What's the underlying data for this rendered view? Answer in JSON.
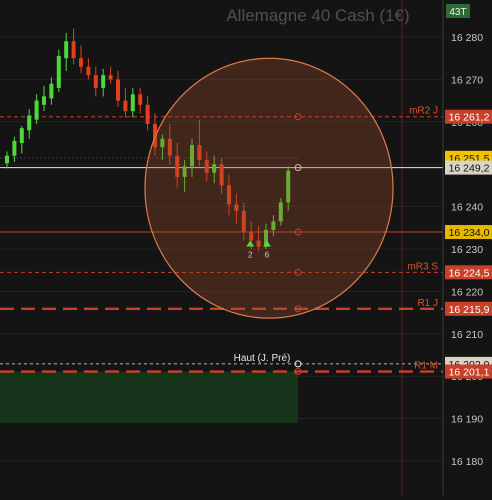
{
  "title": "Allemagne 40 Cash (1€)",
  "timeframe_badge": "43T",
  "colors": {
    "background": "#141414",
    "bull": "#4fd83a",
    "bear": "#e0401f",
    "level_line": "#c8402a",
    "white_line": "#e8e8e8",
    "circle_fill": "#a24f2c",
    "circle_stroke": "#e07a4a",
    "zone_fill": "#16391a",
    "label_bg": "#d8d4c8",
    "axis_text": "#c8c8c8",
    "title_text": "#505050",
    "level_text": "#e05030",
    "grid": "#2a2a2a"
  },
  "chart_data": {
    "type": "candlestick",
    "title": "Allemagne 40 Cash (1€)",
    "instrument": "Allemagne 40 Cash (1€)",
    "timeframe": "43T",
    "ylim": [
      16180,
      16288
    ],
    "y_ticks": [
      16280,
      16270,
      16260,
      16250,
      16240,
      16230,
      16220,
      16210,
      16200,
      16190,
      16180
    ],
    "y_tick_labels": [
      "16 280",
      "16 270",
      "16 260",
      "16 250",
      "16 240",
      "16 230",
      "16 220",
      "16 210",
      "16 200",
      "16 190",
      "16 180"
    ],
    "candles": [
      {
        "o": 16250.2,
        "h": 16253.0,
        "l": 16249.0,
        "c": 16252.0
      },
      {
        "o": 16252.0,
        "h": 16256.5,
        "l": 16250.5,
        "c": 16255.5
      },
      {
        "o": 16255.0,
        "h": 16259.0,
        "l": 16252.5,
        "c": 16258.5
      },
      {
        "o": 16258.0,
        "h": 16263.0,
        "l": 16256.0,
        "c": 16261.5
      },
      {
        "o": 16260.5,
        "h": 16266.5,
        "l": 16259.5,
        "c": 16265.0
      },
      {
        "o": 16264.0,
        "h": 16268.5,
        "l": 16262.5,
        "c": 16266.0
      },
      {
        "o": 16265.5,
        "h": 16270.5,
        "l": 16264.0,
        "c": 16269.0
      },
      {
        "o": 16268.0,
        "h": 16277.0,
        "l": 16267.0,
        "c": 16275.5
      },
      {
        "o": 16275.0,
        "h": 16281.0,
        "l": 16272.0,
        "c": 16279.0
      },
      {
        "o": 16279.0,
        "h": 16282.0,
        "l": 16273.5,
        "c": 16275.0
      },
      {
        "o": 16275.0,
        "h": 16278.0,
        "l": 16271.5,
        "c": 16273.0
      },
      {
        "o": 16273.0,
        "h": 16275.0,
        "l": 16270.0,
        "c": 16271.0
      },
      {
        "o": 16271.0,
        "h": 16273.0,
        "l": 16266.0,
        "c": 16268.0
      },
      {
        "o": 16268.0,
        "h": 16272.5,
        "l": 16266.0,
        "c": 16271.0
      },
      {
        "o": 16271.0,
        "h": 16273.0,
        "l": 16269.0,
        "c": 16270.0
      },
      {
        "o": 16270.0,
        "h": 16272.0,
        "l": 16263.5,
        "c": 16265.0
      },
      {
        "o": 16265.0,
        "h": 16268.0,
        "l": 16261.0,
        "c": 16262.5
      },
      {
        "o": 16262.5,
        "h": 16268.0,
        "l": 16261.0,
        "c": 16266.5
      },
      {
        "o": 16266.5,
        "h": 16268.0,
        "l": 16262.0,
        "c": 16264.0
      },
      {
        "o": 16264.0,
        "h": 16266.0,
        "l": 16258.0,
        "c": 16259.5
      },
      {
        "o": 16259.5,
        "h": 16262.0,
        "l": 16252.0,
        "c": 16254.0
      },
      {
        "o": 16254.0,
        "h": 16257.0,
        "l": 16251.0,
        "c": 16256.0
      },
      {
        "o": 16256.0,
        "h": 16259.5,
        "l": 16250.0,
        "c": 16252.0
      },
      {
        "o": 16252.0,
        "h": 16255.0,
        "l": 16244.5,
        "c": 16247.0
      },
      {
        "o": 16247.0,
        "h": 16251.0,
        "l": 16243.5,
        "c": 16249.5
      },
      {
        "o": 16249.5,
        "h": 16256.0,
        "l": 16247.0,
        "c": 16254.5
      },
      {
        "o": 16254.5,
        "h": 16260.5,
        "l": 16249.5,
        "c": 16251.0
      },
      {
        "o": 16251.0,
        "h": 16253.0,
        "l": 16246.0,
        "c": 16248.0
      },
      {
        "o": 16248.0,
        "h": 16252.0,
        "l": 16245.5,
        "c": 16250.0
      },
      {
        "o": 16250.0,
        "h": 16251.5,
        "l": 16243.0,
        "c": 16245.0
      },
      {
        "o": 16245.0,
        "h": 16247.5,
        "l": 16238.0,
        "c": 16240.5
      },
      {
        "o": 16240.5,
        "h": 16243.0,
        "l": 16236.0,
        "c": 16239.0
      },
      {
        "o": 16239.0,
        "h": 16241.0,
        "l": 16232.0,
        "c": 16234.0
      },
      {
        "o": 16234.0,
        "h": 16236.5,
        "l": 16230.0,
        "c": 16232.0
      },
      {
        "o": 16232.0,
        "h": 16235.5,
        "l": 16229.5,
        "c": 16230.5
      },
      {
        "o": 16230.5,
        "h": 16236.0,
        "l": 16230.0,
        "c": 16234.5
      },
      {
        "o": 16234.5,
        "h": 16238.0,
        "l": 16233.0,
        "c": 16236.5
      },
      {
        "o": 16236.5,
        "h": 16242.0,
        "l": 16235.5,
        "c": 16241.0
      },
      {
        "o": 16241.0,
        "h": 16249.5,
        "l": 16239.0,
        "c": 16248.5
      }
    ],
    "levels": [
      {
        "name": "mR2 J",
        "value": 16261.2,
        "price_label": "16 261,2",
        "style": "dashed-thin"
      },
      {
        "name": "",
        "value": 16251.5,
        "price_label": "16 251,5",
        "style": "none"
      },
      {
        "name": "",
        "value": 16249.2,
        "price_label": "16 249,2",
        "style": "white-solid"
      },
      {
        "name": "",
        "value": 16234.0,
        "price_label": "16 234,0",
        "style": "solid-thin"
      },
      {
        "name": "mR3 S",
        "value": 16224.5,
        "price_label": "16 224,5",
        "style": "dashed-thin"
      },
      {
        "name": "R1 J",
        "value": 16215.9,
        "price_label": "16 215,9",
        "style": "dashed-thick"
      },
      {
        "name": "Haut (J. Pré)",
        "value": 16202.9,
        "price_label": "16 202,9",
        "style": "white-dashed"
      },
      {
        "name": "R1 M",
        "value": 16201.1,
        "price_label": "16 201,1",
        "style": "dashed-thick"
      }
    ],
    "markers": [
      {
        "label": "2",
        "candle_index": 33,
        "direction": "up"
      },
      {
        "label": "6",
        "candle_index": 35,
        "direction": "up"
      }
    ],
    "zone": {
      "from": 16201.1,
      "to": 16189.0
    },
    "circle_highlight": {
      "center_value": 16234.0,
      "top_value": 16270.5,
      "bottom_value": 16221.0
    }
  }
}
